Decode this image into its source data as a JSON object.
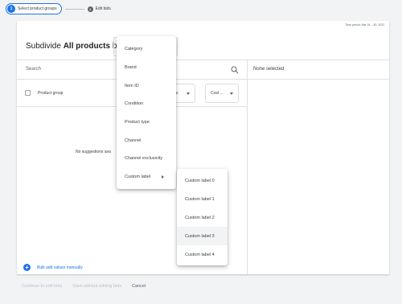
{
  "stepper": {
    "steps": [
      {
        "num": "1",
        "label": "Select product groups"
      },
      {
        "num": "2",
        "label": "Edit bids"
      }
    ]
  },
  "card": {
    "time_period": "Time period: Mar 24 – 30, 2022",
    "subdivide_prefix": "Subdivide ",
    "subdivide_bold": "All products",
    "subdivide_suffix": " by:",
    "search_placeholder": "Search",
    "none_selected": "None selected",
    "product_group_header": "Product group",
    "dropdown1_label": "cks",
    "dropdown2_label": "Cost ...",
    "no_suggestions": "No suggestions ava",
    "no_suggestions_tail": "ually",
    "bulk_add": "Bulk add values manually"
  },
  "footer": {
    "continue": "Continue to edit bids",
    "save": "Save without editing bids",
    "cancel": "Cancel"
  },
  "menu": {
    "items": [
      "Category",
      "Brand",
      "Item ID",
      "Condition",
      "Product type",
      "Channel",
      "Channel exclusivity",
      "Custom label"
    ]
  },
  "submenu": {
    "items": [
      "Custom label 0",
      "Custom label 1",
      "Custom label 2",
      "Custom label 3",
      "Custom label 4"
    ],
    "highlighted_index": 3
  },
  "colors": {
    "accent": "#1a73e8",
    "background": "#f1f3f4"
  },
  "icons": {
    "search": "search-icon",
    "submenu_arrow": "chevron-right-icon",
    "add": "plus-circle-icon"
  }
}
